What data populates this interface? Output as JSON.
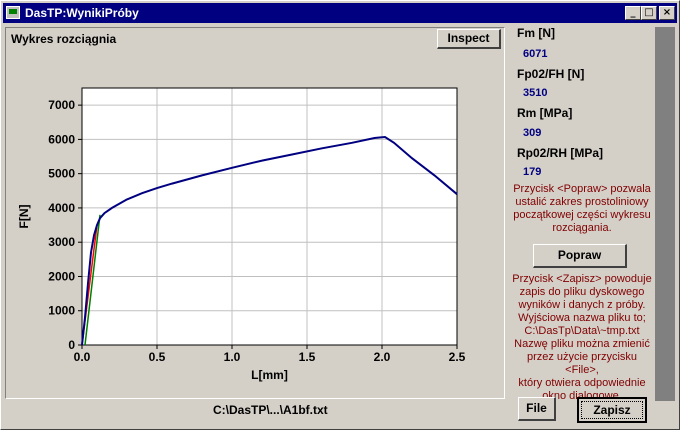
{
  "window": {
    "title": "DasTP:WynikiPróby"
  },
  "title_buttons": {
    "minimize": "_",
    "maximize": "□",
    "close": "×"
  },
  "chart_panel": {
    "title": "Wykres rozciągnia",
    "inspect_label": "Inspect"
  },
  "chart_data": {
    "type": "line",
    "xlabel": "L[mm]",
    "ylabel": "F[N]",
    "xlim": [
      0,
      2.5
    ],
    "ylim": [
      0,
      7500
    ],
    "x_ticks": [
      "0.0",
      "0.5",
      "1.0",
      "1.5",
      "2.0",
      "2.5"
    ],
    "y_ticks": [
      "0",
      "1000",
      "2000",
      "3000",
      "4000",
      "5000",
      "6000",
      "7000"
    ],
    "grid": true,
    "series": [
      {
        "color": "#000080",
        "x": [
          0,
          0.02,
          0.04,
          0.06,
          0.08,
          0.1,
          0.12,
          0.15,
          0.2,
          0.3,
          0.4,
          0.5,
          0.6,
          0.8,
          1.0,
          1.2,
          1.4,
          1.6,
          1.8,
          1.95,
          2.02,
          2.08,
          2.2,
          2.35,
          2.5
        ],
        "y": [
          0,
          800,
          1800,
          2700,
          3200,
          3500,
          3700,
          3850,
          4000,
          4250,
          4430,
          4580,
          4710,
          4950,
          5170,
          5380,
          5560,
          5740,
          5900,
          6040,
          6071,
          5900,
          5450,
          4950,
          4400
        ]
      },
      {
        "color": "#ff0000",
        "x": [
          0,
          0.1
        ],
        "y": [
          0,
          3500
        ]
      },
      {
        "color": "#008000",
        "x": [
          0.02,
          0.12
        ],
        "y": [
          0,
          3800
        ]
      }
    ]
  },
  "results": [
    {
      "label": "Fm [N]",
      "value": "6071"
    },
    {
      "label": "Fp02/FH [N]",
      "value": "3510"
    },
    {
      "label": "Rm [MPa]",
      "value": "309"
    },
    {
      "label": "Rp02/RH [MPa]",
      "value": "179"
    }
  ],
  "help_popraw": [
    "Przycisk <Popraw> pozwala",
    "ustalić zakres prostoliniowy",
    "początkowej części wykresu",
    "rozciągania."
  ],
  "popraw_label": "Popraw",
  "help_zapisz": [
    "Przycisk <Zapisz> powoduje",
    "zapis do pliku dyskowego",
    "wyników i danych z próby.",
    "Wyjściowa nazwa pliku to;",
    "C:\\DasTp\\Data\\~tmp.txt",
    "Nazwę pliku można zmienić",
    "przez użycie przycisku <File>,",
    "który otwiera odpowiednie",
    "okno dialogowe."
  ],
  "file_label": "File",
  "zapisz_label": "Zapisz",
  "file_path": "C:\\DasTP\\...\\A1bf.txt"
}
